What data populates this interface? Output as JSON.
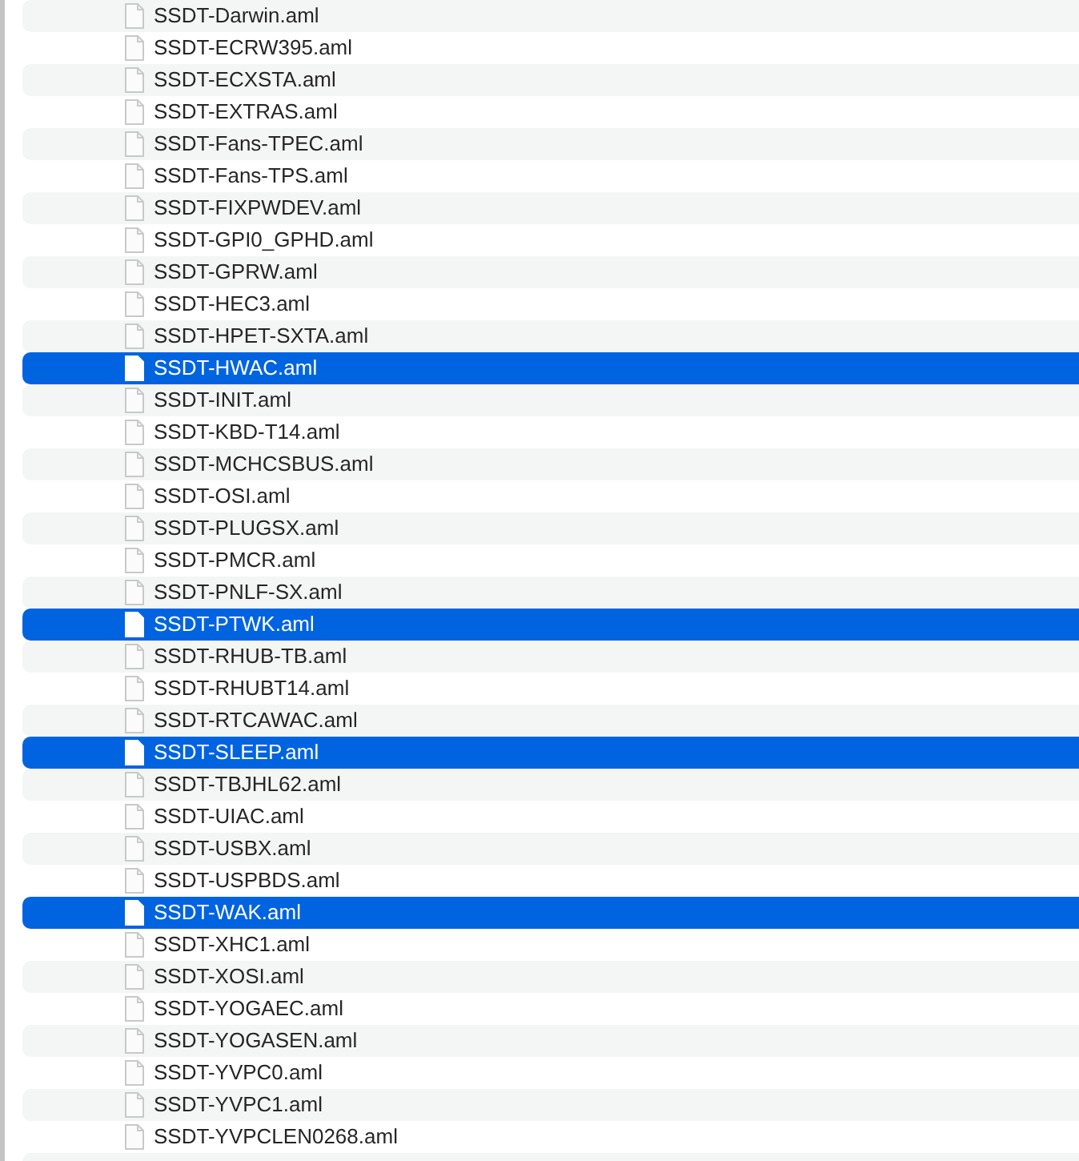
{
  "files": [
    {
      "name": "SSDT-Darwin.aml",
      "selected": false
    },
    {
      "name": "SSDT-ECRW395.aml",
      "selected": false
    },
    {
      "name": "SSDT-ECXSTA.aml",
      "selected": false
    },
    {
      "name": "SSDT-EXTRAS.aml",
      "selected": false
    },
    {
      "name": "SSDT-Fans-TPEC.aml",
      "selected": false
    },
    {
      "name": "SSDT-Fans-TPS.aml",
      "selected": false
    },
    {
      "name": "SSDT-FIXPWDEV.aml",
      "selected": false
    },
    {
      "name": "SSDT-GPI0_GPHD.aml",
      "selected": false
    },
    {
      "name": "SSDT-GPRW.aml",
      "selected": false
    },
    {
      "name": "SSDT-HEC3.aml",
      "selected": false
    },
    {
      "name": "SSDT-HPET-SXTA.aml",
      "selected": false
    },
    {
      "name": "SSDT-HWAC.aml",
      "selected": true
    },
    {
      "name": "SSDT-INIT.aml",
      "selected": false
    },
    {
      "name": "SSDT-KBD-T14.aml",
      "selected": false
    },
    {
      "name": "SSDT-MCHCSBUS.aml",
      "selected": false
    },
    {
      "name": "SSDT-OSI.aml",
      "selected": false
    },
    {
      "name": "SSDT-PLUGSX.aml",
      "selected": false
    },
    {
      "name": "SSDT-PMCR.aml",
      "selected": false
    },
    {
      "name": "SSDT-PNLF-SX.aml",
      "selected": false
    },
    {
      "name": "SSDT-PTWK.aml",
      "selected": true
    },
    {
      "name": "SSDT-RHUB-TB.aml",
      "selected": false
    },
    {
      "name": "SSDT-RHUBT14.aml",
      "selected": false
    },
    {
      "name": "SSDT-RTCAWAC.aml",
      "selected": false
    },
    {
      "name": "SSDT-SLEEP.aml",
      "selected": true
    },
    {
      "name": "SSDT-TBJHL62.aml",
      "selected": false
    },
    {
      "name": "SSDT-UIAC.aml",
      "selected": false
    },
    {
      "name": "SSDT-USBX.aml",
      "selected": false
    },
    {
      "name": "SSDT-USPBDS.aml",
      "selected": false
    },
    {
      "name": "SSDT-WAK.aml",
      "selected": true
    },
    {
      "name": "SSDT-XHC1.aml",
      "selected": false
    },
    {
      "name": "SSDT-XOSI.aml",
      "selected": false
    },
    {
      "name": "SSDT-YOGAEC.aml",
      "selected": false
    },
    {
      "name": "SSDT-YOGASEN.aml",
      "selected": false
    },
    {
      "name": "SSDT-YVPC0.aml",
      "selected": false
    },
    {
      "name": "SSDT-YVPC1.aml",
      "selected": false
    },
    {
      "name": "SSDT-YVPCLEN0268.aml",
      "selected": false
    }
  ]
}
